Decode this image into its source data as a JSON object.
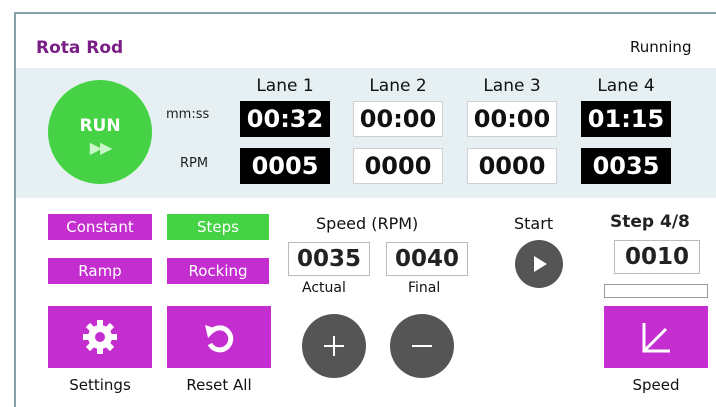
{
  "app": {
    "title": "Rota Rod",
    "status": "Running"
  },
  "run_button": {
    "label": "RUN",
    "arrows": "▶▶"
  },
  "row_labels": {
    "time": "mm:ss",
    "rpm": "RPM"
  },
  "lanes": [
    {
      "name": "Lane 1",
      "time": "00:32",
      "rpm": "0005",
      "active": true
    },
    {
      "name": "Lane 2",
      "time": "00:00",
      "rpm": "0000",
      "active": false
    },
    {
      "name": "Lane 3",
      "time": "00:00",
      "rpm": "0000",
      "active": false
    },
    {
      "name": "Lane 4",
      "time": "01:15",
      "rpm": "0035",
      "active": true
    }
  ],
  "modes": {
    "constant": "Constant",
    "steps": "Steps",
    "ramp": "Ramp",
    "rocking": "Rocking",
    "selected": "Steps"
  },
  "settings": {
    "label": "Settings",
    "icon": "gear-icon"
  },
  "reset": {
    "label": "Reset All",
    "icon": "reset-icon"
  },
  "speed": {
    "title": "Speed (RPM)",
    "actual": "0035",
    "final": "0040",
    "actual_label": "Actual",
    "final_label": "Final"
  },
  "start": {
    "label": "Start",
    "icon": "play-icon"
  },
  "step": {
    "label": "Step 4/8",
    "value": "0010",
    "progress": 0
  },
  "speed_button": {
    "label": "Speed",
    "icon": "speed-profile-icon"
  },
  "colors": {
    "accent": "#c42ed0",
    "green": "#45d245",
    "title": "#7a1f86"
  }
}
